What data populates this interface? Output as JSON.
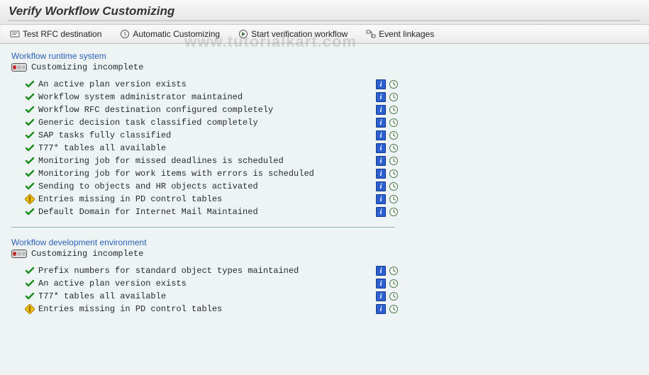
{
  "header": {
    "title": "Verify Workflow Customizing"
  },
  "toolbar": {
    "test_rfc": "Test RFC destination",
    "auto_cust": "Automatic Customizing",
    "start_verif": "Start verification workflow",
    "event_link": "Event linkages"
  },
  "sections": {
    "runtime": {
      "title": "Workflow runtime system",
      "status_text": "Customizing incomplete",
      "status_level": "red",
      "items": [
        {
          "status": "check",
          "label": "An active plan version exists"
        },
        {
          "status": "check",
          "label": "Workflow system administrator maintained"
        },
        {
          "status": "check",
          "label": "Workflow RFC destination configured completely"
        },
        {
          "status": "check",
          "label": "Generic decision task classified completely"
        },
        {
          "status": "check",
          "label": "SAP tasks fully classified"
        },
        {
          "status": "check",
          "label": "T77* tables all available"
        },
        {
          "status": "check",
          "label": "Monitoring job for missed deadlines is scheduled"
        },
        {
          "status": "check",
          "label": "Monitoring job for work items with errors is scheduled"
        },
        {
          "status": "check",
          "label": "Sending to objects and HR objects activated"
        },
        {
          "status": "warn",
          "label": "Entries missing in PD control tables"
        },
        {
          "status": "check",
          "label": "Default Domain for Internet Mail Maintained"
        }
      ]
    },
    "devenv": {
      "title": "Workflow development environment",
      "status_text": "Customizing incomplete",
      "status_level": "red",
      "items": [
        {
          "status": "check",
          "label": "Prefix numbers for standard object types maintained"
        },
        {
          "status": "check",
          "label": "An active plan version exists"
        },
        {
          "status": "check",
          "label": "T77* tables all available"
        },
        {
          "status": "warn",
          "label": "Entries missing in PD control tables"
        }
      ]
    }
  },
  "watermark": "www.tutorialkart.com"
}
